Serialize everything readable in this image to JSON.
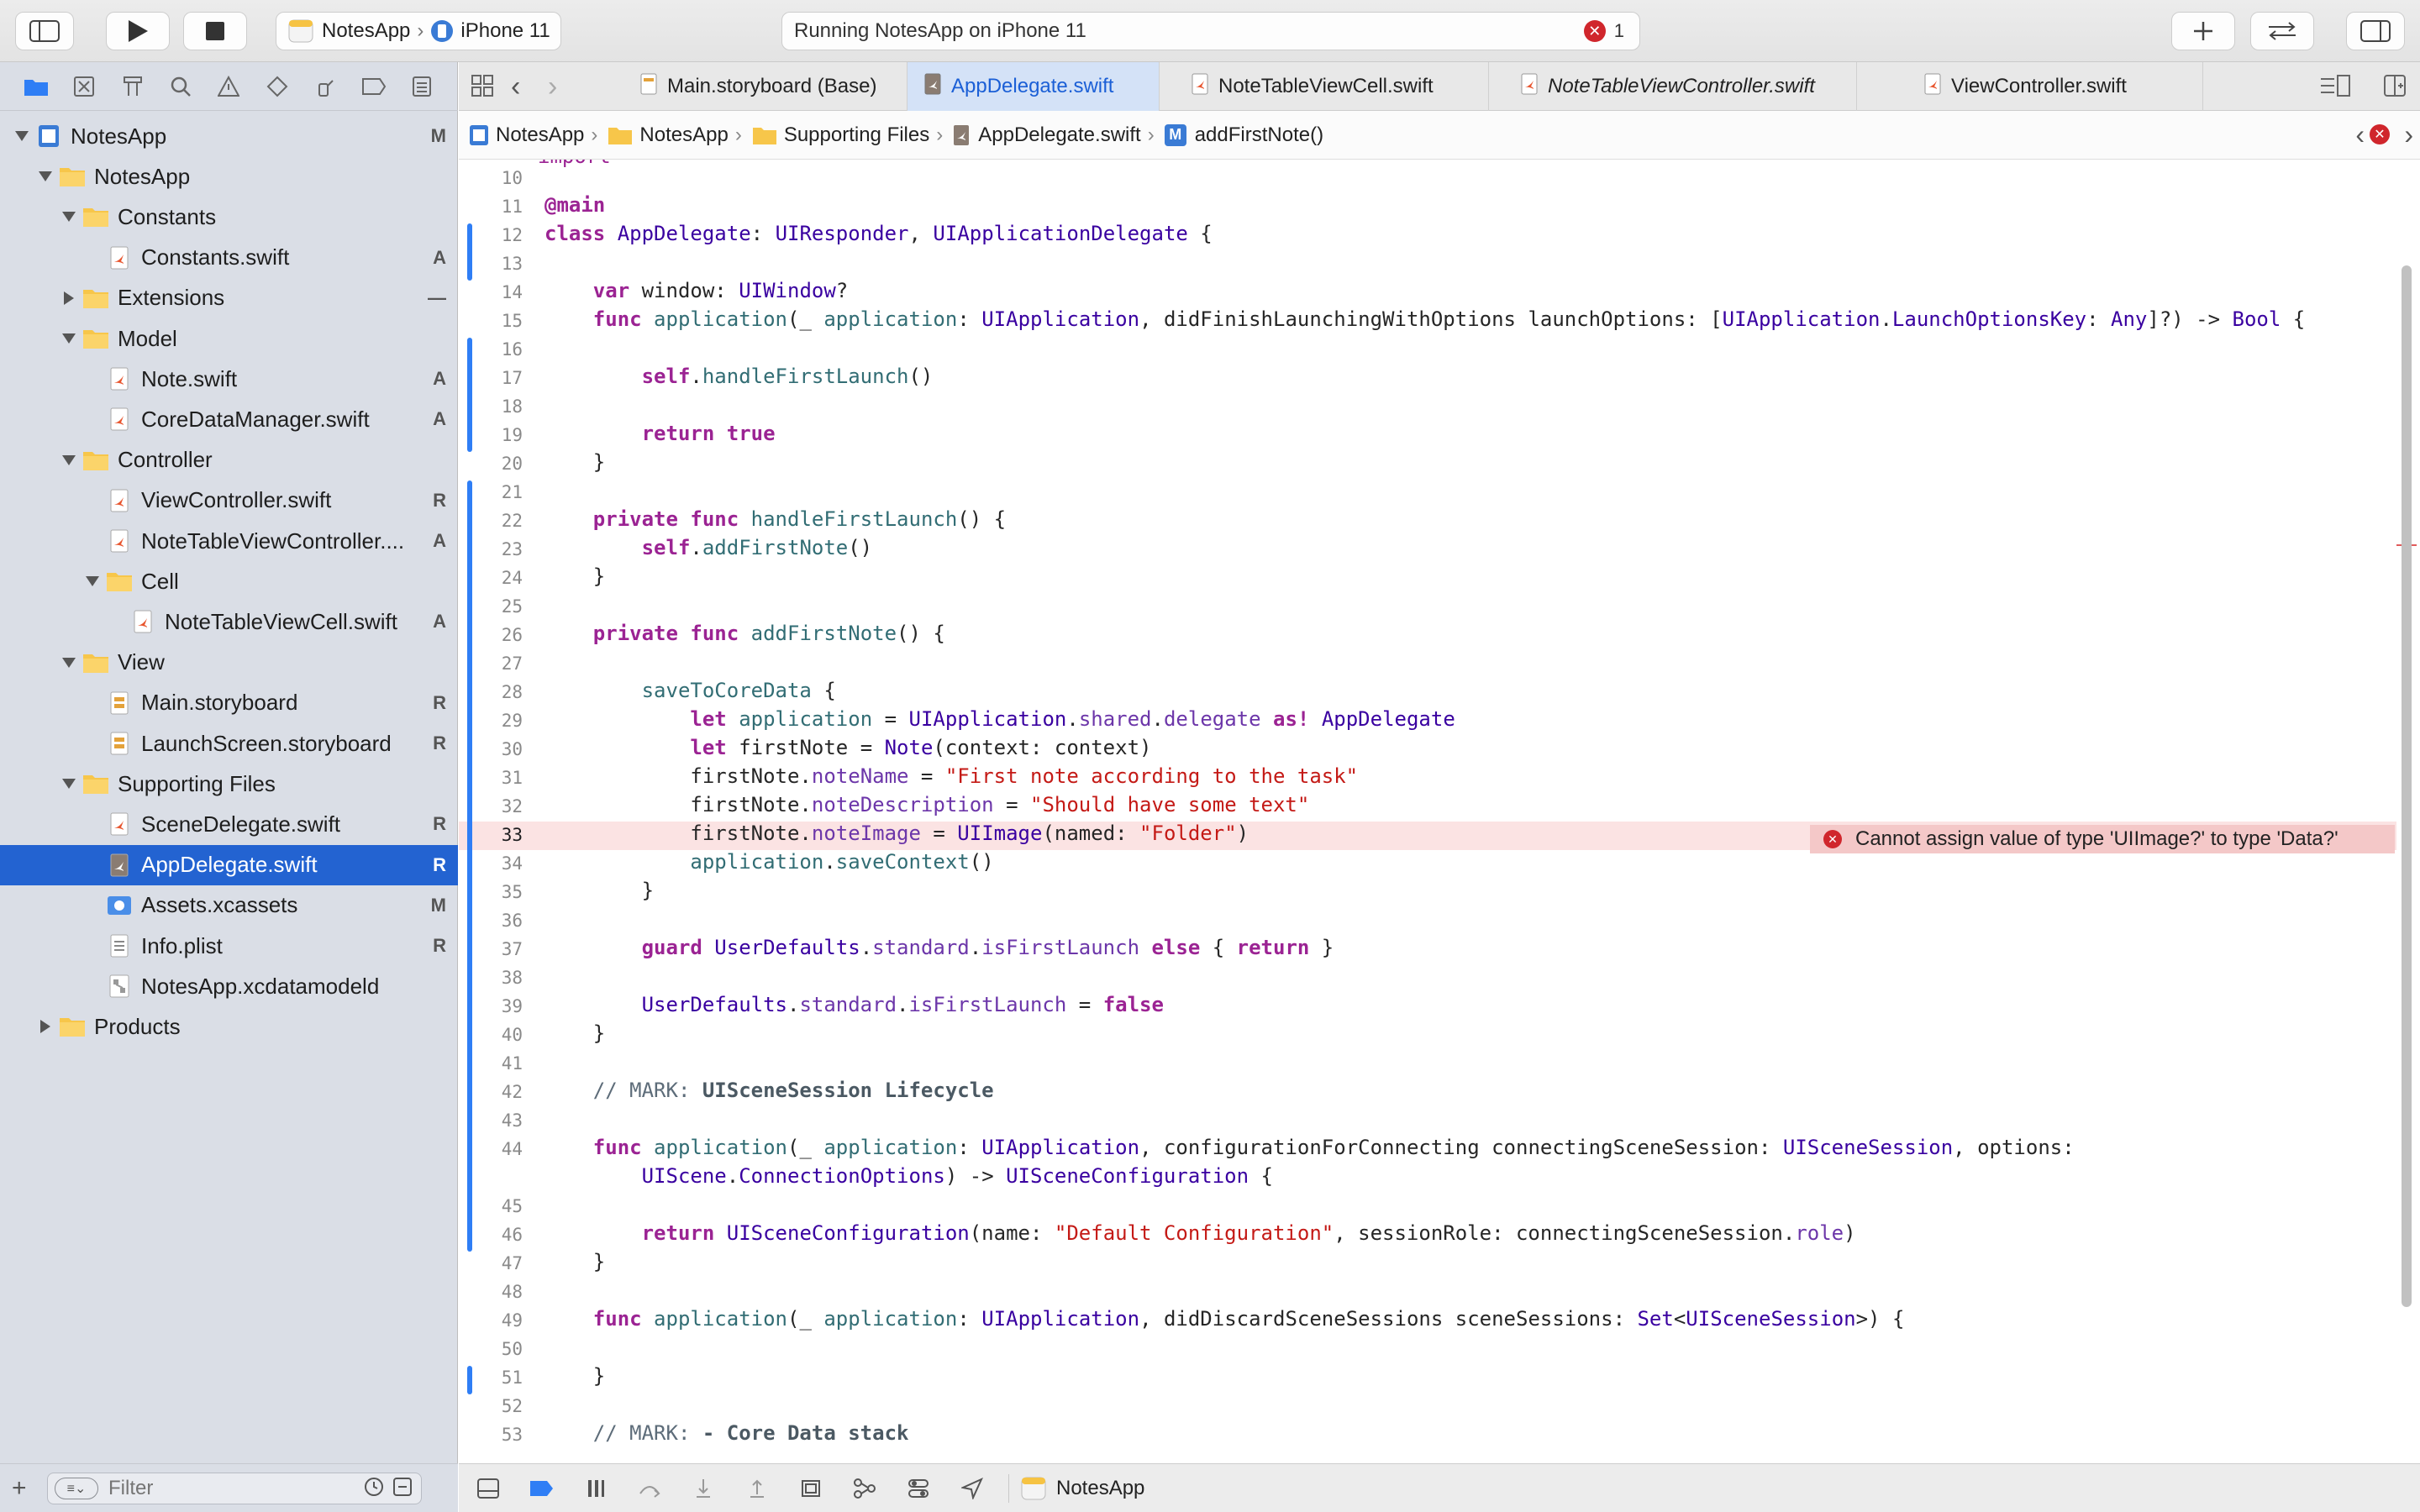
{
  "toolbar": {
    "scheme_app": "NotesApp",
    "scheme_device": "iPhone 11",
    "status_text": "Running NotesApp on iPhone 11",
    "error_count": "1"
  },
  "tabs": [
    {
      "label": "Main.storyboard (Base)"
    },
    {
      "label": "AppDelegate.swift"
    },
    {
      "label": "NoteTableViewCell.swift"
    },
    {
      "label": "NoteTableViewController.swift"
    },
    {
      "label": "ViewController.swift"
    }
  ],
  "breadcrumb": [
    "NotesApp",
    "NotesApp",
    "Supporting Files",
    "AppDelegate.swift",
    "addFirstNote()"
  ],
  "navigator": {
    "filter_placeholder": "Filter",
    "items": [
      {
        "label": "NotesApp",
        "status": "M",
        "depth": 0,
        "kind": "project",
        "open": true
      },
      {
        "label": "NotesApp",
        "status": "",
        "depth": 1,
        "kind": "folder",
        "open": true
      },
      {
        "label": "Constants",
        "status": "",
        "depth": 2,
        "kind": "folder",
        "open": true
      },
      {
        "label": "Constants.swift",
        "status": "A",
        "depth": 3,
        "kind": "swift"
      },
      {
        "label": "Extensions",
        "status": "—",
        "depth": 2,
        "kind": "folder",
        "open": false
      },
      {
        "label": "Model",
        "status": "",
        "depth": 2,
        "kind": "folder",
        "open": true
      },
      {
        "label": "Note.swift",
        "status": "A",
        "depth": 3,
        "kind": "swift"
      },
      {
        "label": "CoreDataManager.swift",
        "status": "A",
        "depth": 3,
        "kind": "swift"
      },
      {
        "label": "Controller",
        "status": "",
        "depth": 2,
        "kind": "folder",
        "open": true
      },
      {
        "label": "ViewController.swift",
        "status": "R",
        "depth": 3,
        "kind": "swift"
      },
      {
        "label": "NoteTableViewController....",
        "status": "A",
        "depth": 3,
        "kind": "swift"
      },
      {
        "label": "Cell",
        "status": "",
        "depth": 3,
        "kind": "folder",
        "open": true
      },
      {
        "label": "NoteTableViewCell.swift",
        "status": "A",
        "depth": 4,
        "kind": "swift"
      },
      {
        "label": "View",
        "status": "",
        "depth": 2,
        "kind": "folder",
        "open": true
      },
      {
        "label": "Main.storyboard",
        "status": "R",
        "depth": 3,
        "kind": "storyboard"
      },
      {
        "label": "LaunchScreen.storyboard",
        "status": "R",
        "depth": 3,
        "kind": "storyboard"
      },
      {
        "label": "Supporting Files",
        "status": "",
        "depth": 2,
        "kind": "folder",
        "open": true
      },
      {
        "label": "SceneDelegate.swift",
        "status": "R",
        "depth": 3,
        "kind": "swift"
      },
      {
        "label": "AppDelegate.swift",
        "status": "R",
        "depth": 3,
        "kind": "swift",
        "selected": true
      },
      {
        "label": "Assets.xcassets",
        "status": "M",
        "depth": 3,
        "kind": "assets"
      },
      {
        "label": "Info.plist",
        "status": "R",
        "depth": 3,
        "kind": "plist"
      },
      {
        "label": "NotesApp.xcdatamodeld",
        "status": "",
        "depth": 3,
        "kind": "datamodel"
      },
      {
        "label": "Products",
        "status": "",
        "depth": 1,
        "kind": "folder",
        "open": false
      }
    ]
  },
  "editor": {
    "error_message": "Cannot assign value of type 'UIImage?' to type 'Data?'",
    "lines": [
      {
        "n": "10",
        "t": ""
      },
      {
        "n": "11",
        "t": "@main"
      },
      {
        "n": "12",
        "t": "class AppDelegate: UIResponder, UIApplicationDelegate {"
      },
      {
        "n": "13",
        "t": ""
      },
      {
        "n": "14",
        "t": "    var window: UIWindow?"
      },
      {
        "n": "15",
        "t": "    func application(_ application: UIApplication, didFinishLaunchingWithOptions launchOptions: [UIApplication.LaunchOptionsKey: Any]?) -> Bool {"
      },
      {
        "n": "16",
        "t": ""
      },
      {
        "n": "17",
        "t": "        self.handleFirstLaunch()"
      },
      {
        "n": "18",
        "t": ""
      },
      {
        "n": "19",
        "t": "        return true"
      },
      {
        "n": "20",
        "t": "    }"
      },
      {
        "n": "21",
        "t": ""
      },
      {
        "n": "22",
        "t": "    private func handleFirstLaunch() {"
      },
      {
        "n": "23",
        "t": "        self.addFirstNote()"
      },
      {
        "n": "24",
        "t": "    }"
      },
      {
        "n": "25",
        "t": ""
      },
      {
        "n": "26",
        "t": "    private func addFirstNote() {"
      },
      {
        "n": "27",
        "t": ""
      },
      {
        "n": "28",
        "t": "        saveToCoreData {"
      },
      {
        "n": "29",
        "t": "            let application = UIApplication.shared.delegate as! AppDelegate"
      },
      {
        "n": "30",
        "t": "            let firstNote = Note(context: context)"
      },
      {
        "n": "31",
        "t": "            firstNote.noteName = \"First note according to the task\""
      },
      {
        "n": "32",
        "t": "            firstNote.noteDescription = \"Should have some text\""
      },
      {
        "n": "33",
        "t": "            firstNote.noteImage = UIImage(named: \"Folder\")",
        "err": true
      },
      {
        "n": "34",
        "t": "            application.saveContext()"
      },
      {
        "n": "35",
        "t": "        }"
      },
      {
        "n": "36",
        "t": ""
      },
      {
        "n": "37",
        "t": "        guard UserDefaults.standard.isFirstLaunch else { return }"
      },
      {
        "n": "38",
        "t": ""
      },
      {
        "n": "39",
        "t": "        UserDefaults.standard.isFirstLaunch = false"
      },
      {
        "n": "40",
        "t": "    }"
      },
      {
        "n": "41",
        "t": ""
      },
      {
        "n": "42",
        "t": "    // MARK: UISceneSession Lifecycle"
      },
      {
        "n": "43",
        "t": ""
      },
      {
        "n": "44",
        "t": "    func application(_ application: UIApplication, configurationForConnecting connectingSceneSession: UISceneSession, options:"
      },
      {
        "n": "",
        "t": "        UIScene.ConnectionOptions) -> UISceneConfiguration {"
      },
      {
        "n": "45",
        "t": ""
      },
      {
        "n": "46",
        "t": "        return UISceneConfiguration(name: \"Default Configuration\", sessionRole: connectingSceneSession.role)"
      },
      {
        "n": "47",
        "t": "    }"
      },
      {
        "n": "48",
        "t": ""
      },
      {
        "n": "49",
        "t": "    func application(_ application: UIApplication, didDiscardSceneSessions sceneSessions: Set<UISceneSession>) {"
      },
      {
        "n": "50",
        "t": ""
      },
      {
        "n": "51",
        "t": "    }"
      },
      {
        "n": "52",
        "t": ""
      },
      {
        "n": "53",
        "t": "    // MARK: - Core Data stack"
      }
    ]
  },
  "debugbar": {
    "target_label": "NotesApp"
  },
  "colors": {
    "selection": "#2363d1",
    "accent": "#1b5fd6",
    "error": "#d0262c"
  }
}
